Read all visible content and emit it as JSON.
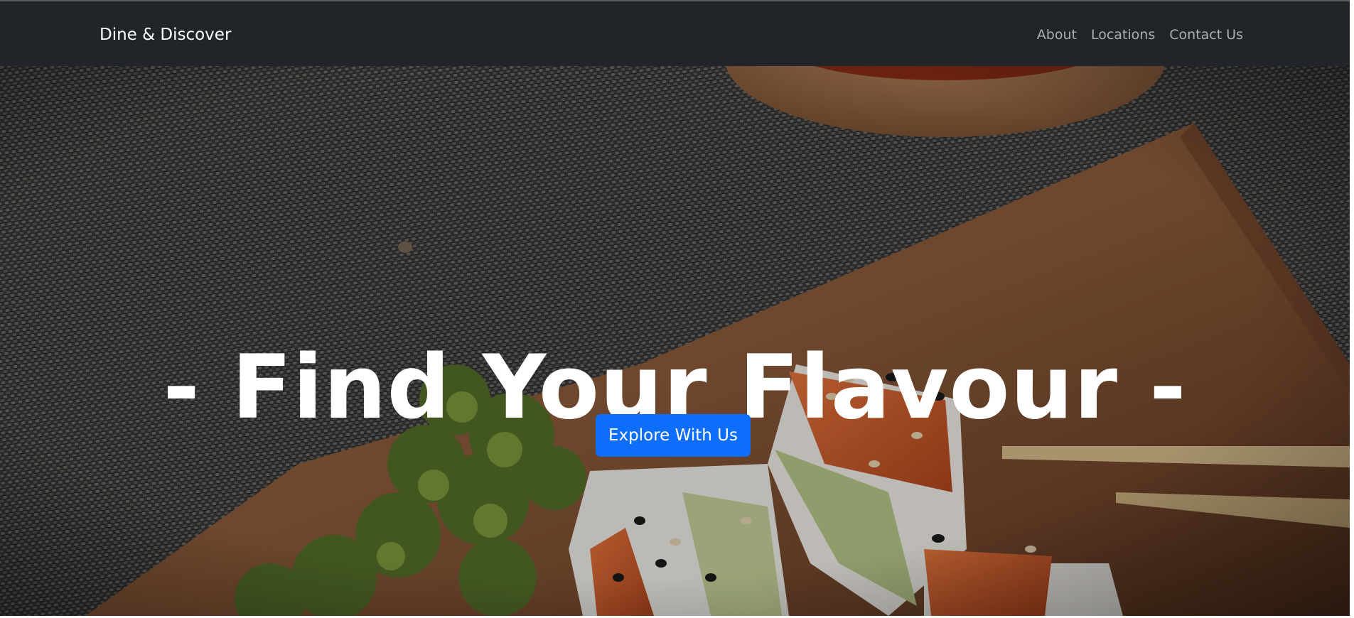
{
  "navbar": {
    "brand": "Dine & Discover",
    "links": [
      {
        "label": "About"
      },
      {
        "label": "Locations"
      },
      {
        "label": "Contact Us"
      }
    ]
  },
  "hero": {
    "title": "- Find Your Flavour -",
    "cta_label": "Explore With Us",
    "background_image": "sushi-on-wooden-board-photo"
  },
  "colors": {
    "navbar_bg": "#212529",
    "cta_bg": "#0d6efd",
    "text_light": "#ffffff"
  }
}
